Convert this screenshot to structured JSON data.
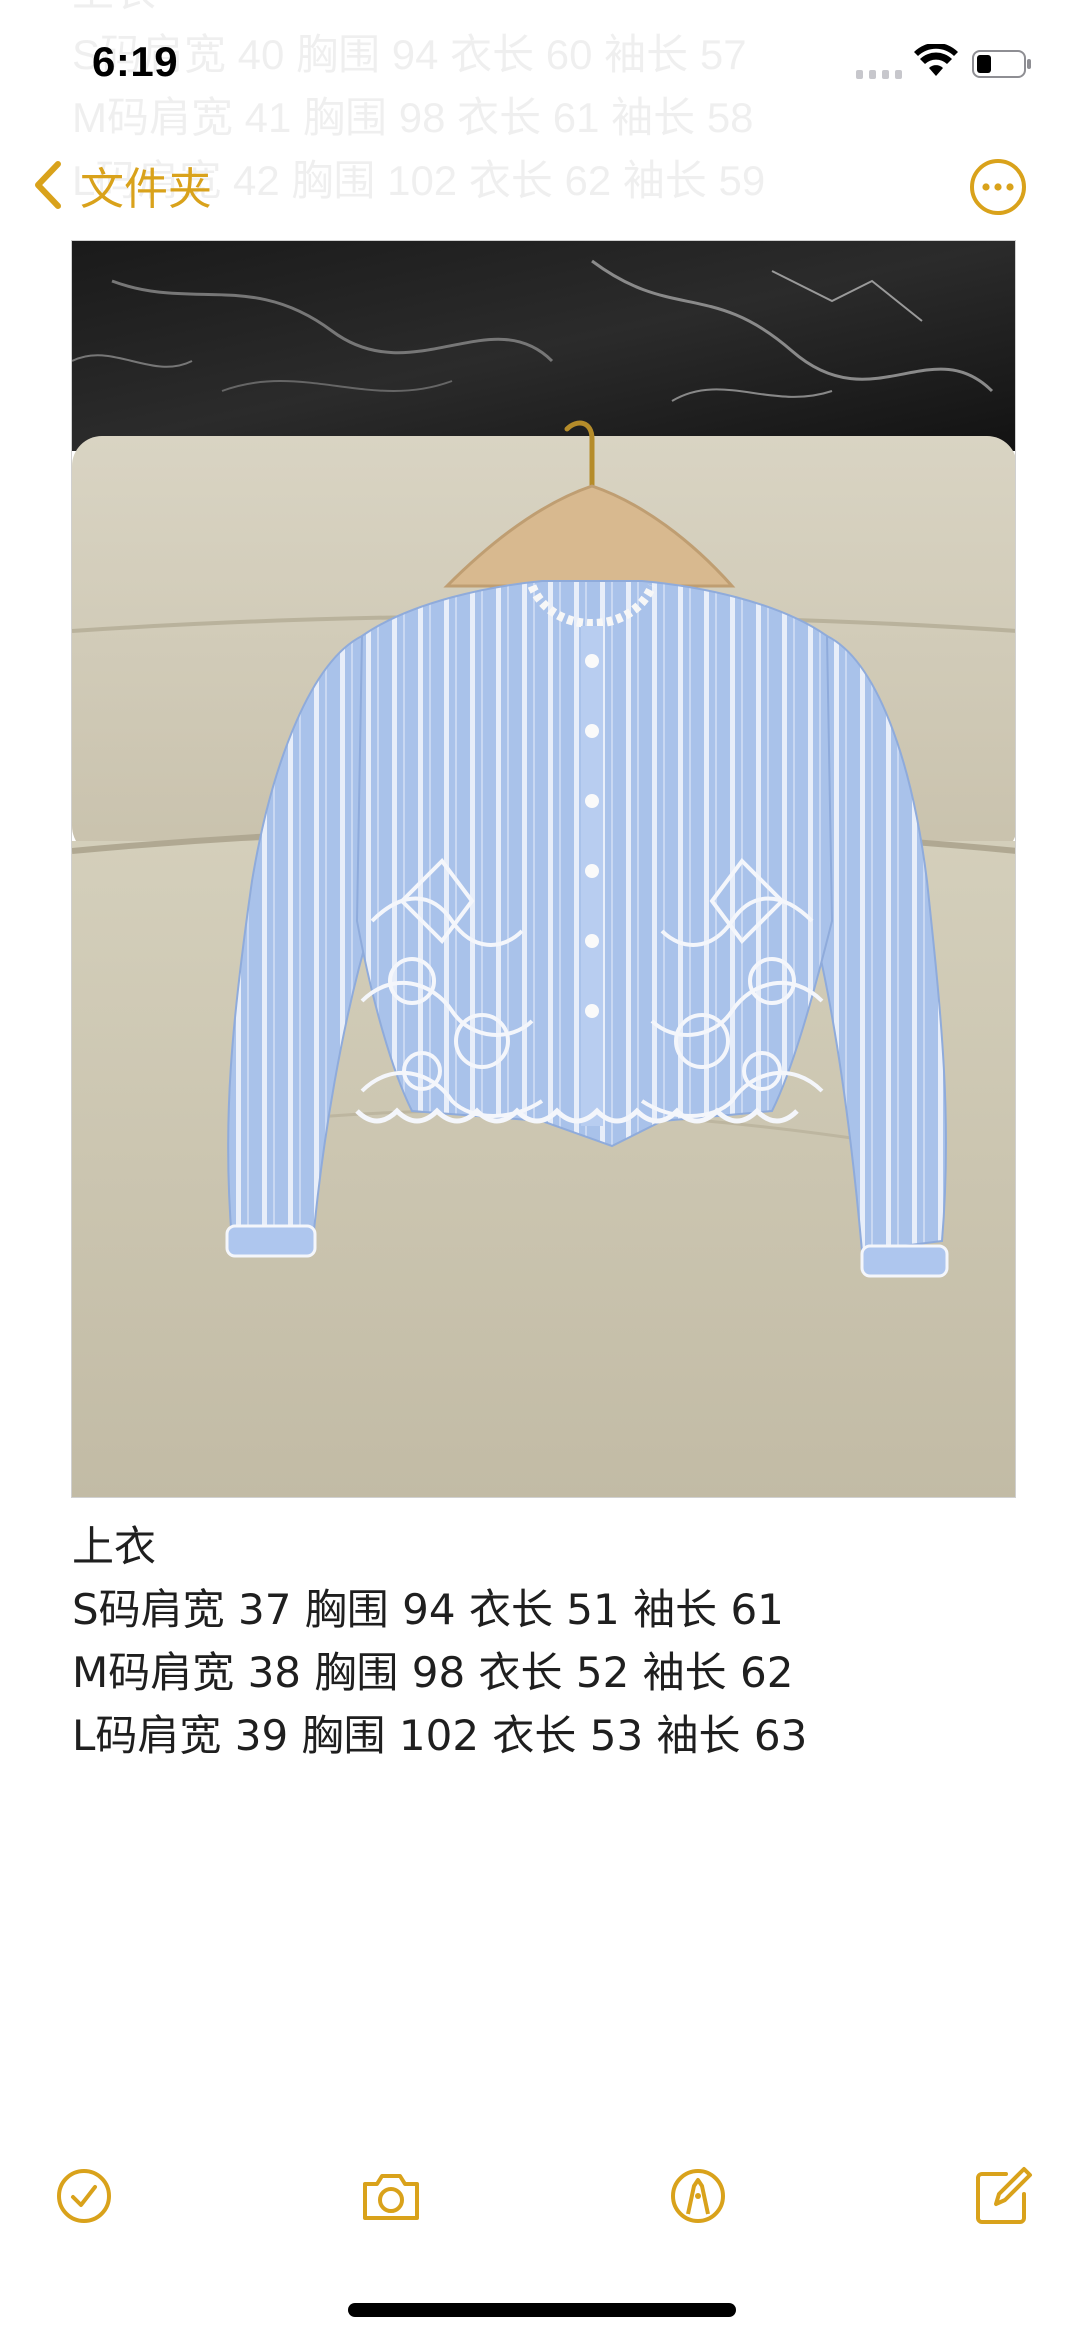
{
  "status_bar": {
    "time": "6:19"
  },
  "nav": {
    "back_label": "文件夹",
    "back_icon": "chevron-left-icon",
    "more_icon": "ellipsis-circle-icon"
  },
  "ghost_lines": [
    "上衣",
    "S码肩宽 40 胸围 94 衣长 60 袖长 57",
    "M码肩宽 41 胸围 98 衣长 61 袖长 58",
    "L码肩宽 42 胸围 102 衣长 62 袖长 59"
  ],
  "note": {
    "lines": [
      "上衣",
      " S码肩宽 37 胸围 94 衣长 51 袖长 61",
      "M码肩宽 38 胸围 98 衣长 52 袖长 62",
      "L码肩宽 39 胸围 102 衣长 53 袖长 63"
    ]
  },
  "toolbar": {
    "checklist_icon": "checkmark-circle-icon",
    "camera_icon": "camera-icon",
    "markup_icon": "pen-tip-circle-icon",
    "compose_icon": "compose-icon"
  },
  "colors": {
    "accent": "#d9a21b",
    "text": "#1f1f1f",
    "background": "#ffffff"
  }
}
